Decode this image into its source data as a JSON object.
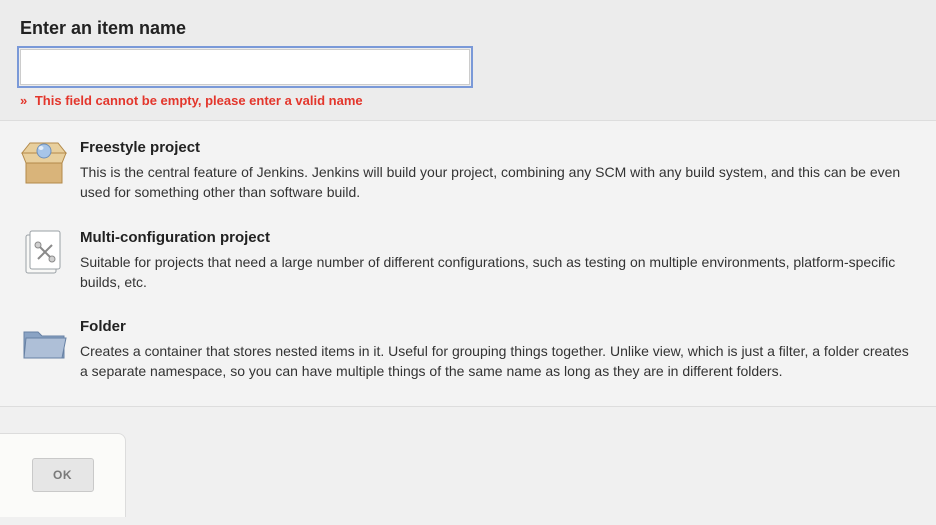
{
  "header": {
    "title": "Enter an item name",
    "input_value": "",
    "error_prefix": "»",
    "error_text": "This field cannot be empty, please enter a valid name"
  },
  "options": [
    {
      "icon": "box-icon",
      "title": "Freestyle project",
      "desc": "This is the central feature of Jenkins. Jenkins will build your project, combining any SCM with any build system, and this can be even used for something other than software build."
    },
    {
      "icon": "tools-icon",
      "title": "Multi-configuration project",
      "desc": "Suitable for projects that need a large number of different configurations, such as testing on multiple environments, platform-specific builds, etc."
    },
    {
      "icon": "folder-icon",
      "title": "Folder",
      "desc": "Creates a container that stores nested items in it. Useful for grouping things together. Unlike view, which is just a filter, a folder creates a separate namespace, so you can have multiple things of the same name as long as they are in different folders."
    }
  ],
  "footer": {
    "ok_label": "OK"
  }
}
